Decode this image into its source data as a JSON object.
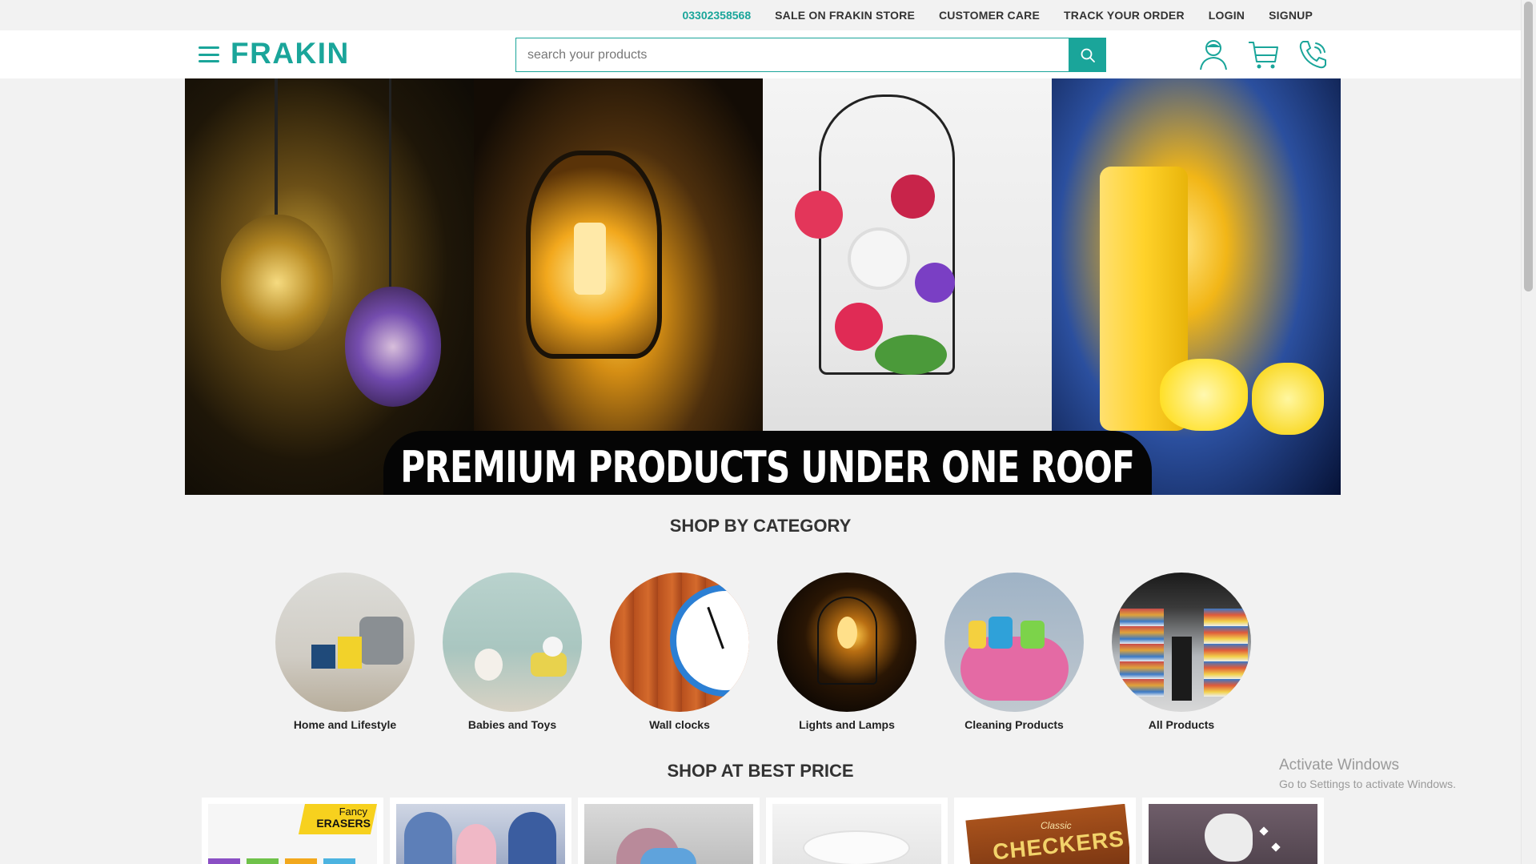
{
  "topbar": {
    "phone": "03302358568",
    "links": [
      "SALE ON FRAKIN STORE",
      "CUSTOMER CARE",
      "TRACK YOUR ORDER",
      "LOGIN",
      "SIGNUP"
    ]
  },
  "header": {
    "logo": "FRAKIN",
    "search_placeholder": "search your products",
    "icons": [
      "user-icon",
      "cart-icon",
      "phone-icon"
    ]
  },
  "banner": {
    "title": "PREMIUM PRODUCTS UNDER ONE ROOF"
  },
  "categories": {
    "title": "SHOP BY CATEGORY",
    "items": [
      {
        "label": "Home and Lifestyle"
      },
      {
        "label": "Babies and Toys"
      },
      {
        "label": "Wall clocks"
      },
      {
        "label": "Lights and Lamps"
      },
      {
        "label": "Cleaning Products"
      },
      {
        "label": "All Products"
      }
    ]
  },
  "best_price": {
    "title": "SHOP AT BEST PRICE",
    "tile_texts": {
      "eraser_small": "Fancy",
      "eraser_big": "ERASERS",
      "checkers_small": "Classic",
      "checkers_big": "CHECKERS"
    }
  },
  "watermark": {
    "title": "Activate Windows",
    "subtitle": "Go to Settings to activate Windows."
  },
  "colors": {
    "brand": "#1aa59a"
  }
}
